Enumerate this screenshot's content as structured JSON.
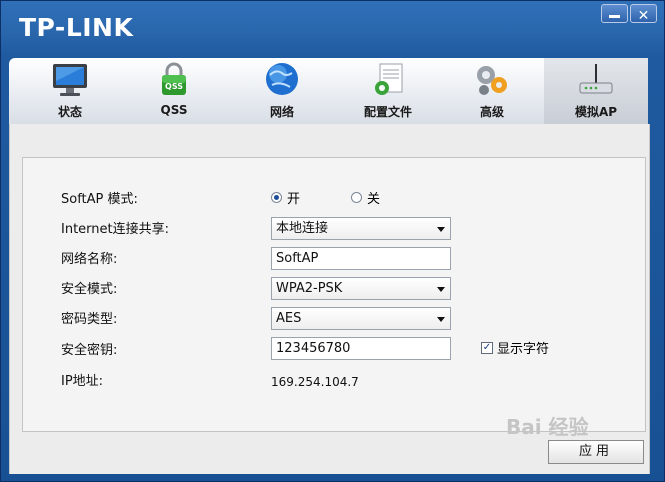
{
  "window": {
    "brand": "TP-LINK",
    "minimize_label": "",
    "close_label": "✕"
  },
  "tabs": [
    {
      "label": "状态",
      "icon": "monitor-icon"
    },
    {
      "label": "QSS",
      "icon": "qss-lock-icon"
    },
    {
      "label": "网络",
      "icon": "globe-icon"
    },
    {
      "label": "配置文件",
      "icon": "profile-document-icon"
    },
    {
      "label": "高级",
      "icon": "gears-icon"
    },
    {
      "label": "模拟AP",
      "icon": "router-icon",
      "active": true
    }
  ],
  "form": {
    "softap_mode_label": "SoftAP 模式:",
    "mode_on_label": "开",
    "mode_off_label": "关",
    "mode_selected": "开",
    "sharing_label": "Internet连接共享:",
    "sharing_value": "本地连接",
    "ssid_label": "网络名称:",
    "ssid_value": "SoftAP",
    "security_label": "安全模式:",
    "security_value": "WPA2-PSK",
    "cipher_label": "密码类型:",
    "cipher_value": "AES",
    "key_label": "安全密钥:",
    "key_value": "123456780",
    "show_chars_label": "显示字符",
    "show_chars_checked": true,
    "ip_label": "IP地址:",
    "ip_value": "169.254.104.7"
  },
  "apply_label": "应用",
  "watermark": "Bai 经验",
  "colors": {
    "title_bar": "#2a67ad",
    "panel_bg": "#f4f4f4"
  }
}
